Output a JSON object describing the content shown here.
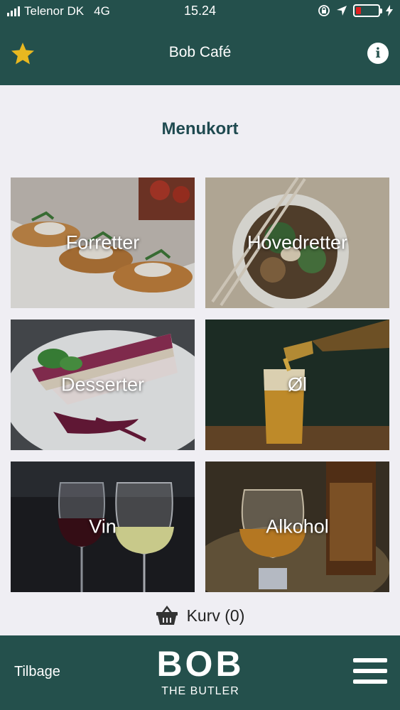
{
  "status_bar": {
    "carrier": "Telenor DK",
    "network": "4G",
    "time": "15.24"
  },
  "header": {
    "title": "Bob Café"
  },
  "main": {
    "heading": "Menukort",
    "categories": [
      {
        "label": "Forretter"
      },
      {
        "label": "Hovedretter"
      },
      {
        "label": "Desserter"
      },
      {
        "label": "Øl"
      },
      {
        "label": "Vin"
      },
      {
        "label": "Alkohol"
      }
    ]
  },
  "cart": {
    "label": "Kurv (0)"
  },
  "footer": {
    "back_label": "Tilbage",
    "logo_text": "BOB",
    "logo_subtitle": "THE BUTLER"
  },
  "colors": {
    "primary": "#24504c",
    "heading": "#1f4a50",
    "star": "#e8b820",
    "battery_low": "#e02020"
  }
}
